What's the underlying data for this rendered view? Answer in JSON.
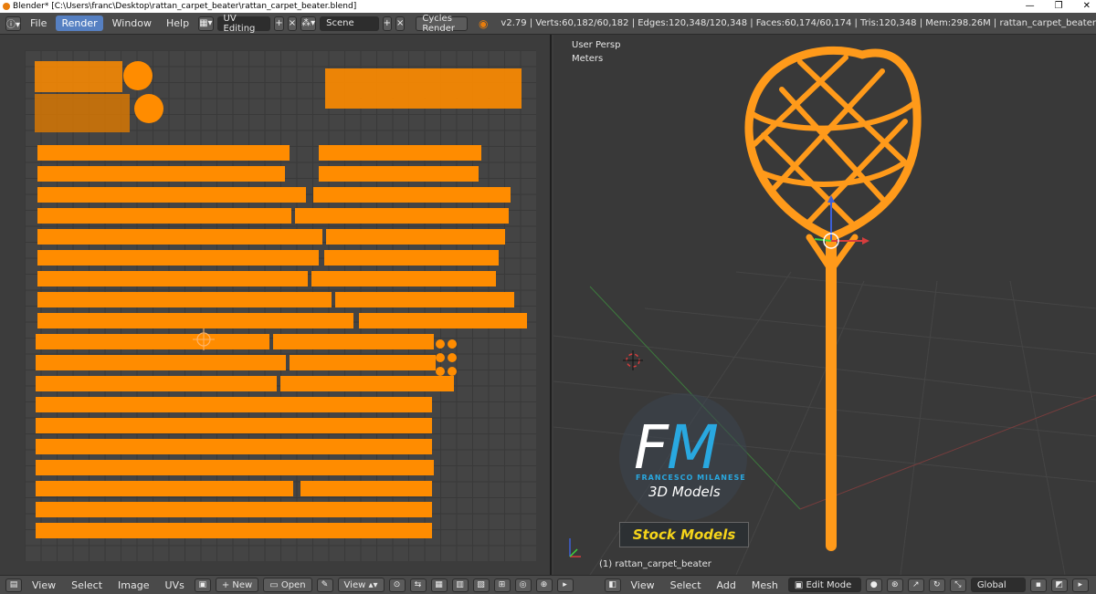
{
  "window": {
    "title": "Blender* [C:\\Users\\franc\\Desktop\\rattan_carpet_beater\\rattan_carpet_beater.blend]",
    "minimize": "—",
    "maximize": "❐",
    "close": "✕"
  },
  "topbar": {
    "menus": [
      "File",
      "Render",
      "Window",
      "Help"
    ],
    "active_menu": "Render",
    "screen_layout": "UV Editing",
    "scene": "Scene",
    "engine": "Cycles Render",
    "stats": "v2.79 | Verts:60,182/60,182 | Edges:120,348/120,348 | Faces:60,174/60,174 | Tris:120,348 | Mem:298.26M | rattan_carpet_beater"
  },
  "viewport": {
    "view_name": "User Persp",
    "units": "Meters",
    "object_label": "(1) rattan_carpet_beater"
  },
  "watermark": {
    "letter_f": "F",
    "letter_m": "M",
    "name": "FRANCESCO MILANESE",
    "subtitle": "3D Models",
    "badge": "Stock Models"
  },
  "uv_bottom": {
    "menus": [
      "View",
      "Select",
      "Image",
      "UVs"
    ],
    "new_label": "New",
    "open_label": "Open",
    "view_label": "View"
  },
  "view_bottom": {
    "menus": [
      "View",
      "Select",
      "Add",
      "Mesh"
    ],
    "mode": "Edit Mode",
    "orientation": "Global"
  },
  "colors": {
    "uv_orange": "#ff8c00",
    "mesh_orange": "#ff9a1a",
    "accent_blue": "#5680c2",
    "fm_blue": "#29a8e0",
    "badge_yellow": "#f5d41a"
  }
}
